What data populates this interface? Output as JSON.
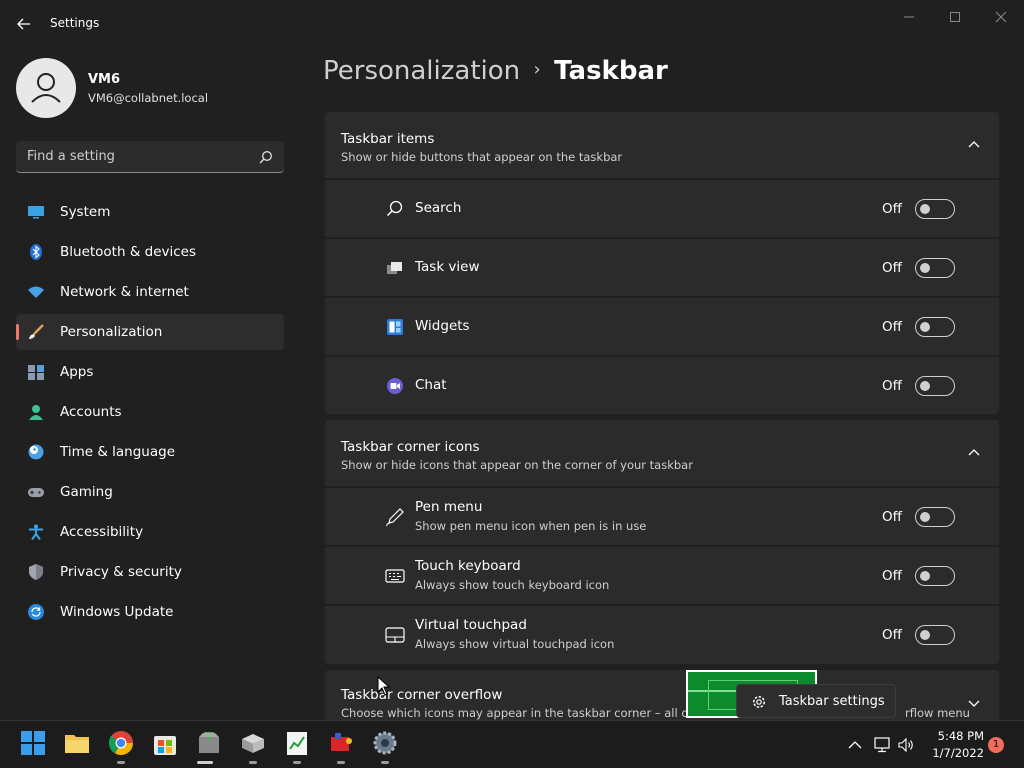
{
  "window": {
    "title": "Settings",
    "back_icon": "arrow-left-icon",
    "controls": [
      "minimize-icon",
      "restore-icon",
      "close-icon"
    ]
  },
  "profile": {
    "name": "VM6",
    "email": "VM6@collabnet.local"
  },
  "search": {
    "placeholder": "Find a setting",
    "value": ""
  },
  "nav": {
    "items": [
      {
        "label": "System",
        "icon": "monitor-icon",
        "active": false
      },
      {
        "label": "Bluetooth & devices",
        "icon": "bluetooth-icon",
        "active": false
      },
      {
        "label": "Network & internet",
        "icon": "wifi-icon",
        "active": false
      },
      {
        "label": "Personalization",
        "icon": "brush-icon",
        "active": true
      },
      {
        "label": "Apps",
        "icon": "apps-icon",
        "active": false
      },
      {
        "label": "Accounts",
        "icon": "person-icon",
        "active": false
      },
      {
        "label": "Time & language",
        "icon": "clock-globe-icon",
        "active": false
      },
      {
        "label": "Gaming",
        "icon": "gamepad-icon",
        "active": false
      },
      {
        "label": "Accessibility",
        "icon": "accessibility-icon",
        "active": false
      },
      {
        "label": "Privacy & security",
        "icon": "shield-icon",
        "active": false
      },
      {
        "label": "Windows Update",
        "icon": "update-icon",
        "active": false
      }
    ]
  },
  "breadcrumb": {
    "parent": "Personalization",
    "separator": "›",
    "current": "Taskbar"
  },
  "sections": {
    "taskbar_items": {
      "title": "Taskbar items",
      "subtitle": "Show or hide buttons that appear on the taskbar",
      "expanded": true,
      "rows": [
        {
          "title": "Search",
          "icon": "search-icon",
          "state": "Off"
        },
        {
          "title": "Task view",
          "icon": "task-view-icon",
          "state": "Off"
        },
        {
          "title": "Widgets",
          "icon": "widgets-icon",
          "state": "Off"
        },
        {
          "title": "Chat",
          "icon": "chat-icon",
          "state": "Off"
        }
      ]
    },
    "corner_icons": {
      "title": "Taskbar corner icons",
      "subtitle": "Show or hide icons that appear on the corner of your taskbar",
      "expanded": true,
      "rows": [
        {
          "title": "Pen menu",
          "subtitle": "Show pen menu icon when pen is in use",
          "icon": "pen-icon",
          "state": "Off"
        },
        {
          "title": "Touch keyboard",
          "subtitle": "Always show touch keyboard icon",
          "icon": "keyboard-icon",
          "state": "Off"
        },
        {
          "title": "Virtual touchpad",
          "subtitle": "Always show virtual touchpad icon",
          "icon": "touchpad-icon",
          "state": "Off"
        }
      ]
    },
    "corner_overflow": {
      "title": "Taskbar corner overflow",
      "subtitle": "Choose which icons may appear in the taskbar corner – all other",
      "subtitle_tail": "rflow menu",
      "expanded": false
    }
  },
  "tooltip": {
    "label": "Taskbar settings",
    "icon": "gear-icon"
  },
  "taskbar": {
    "apps": [
      "start-icon",
      "file-explorer-icon",
      "chrome-icon",
      "store-icon",
      "install-app-icon",
      "server-app-icon",
      "chart-app-icon",
      "media-app-icon",
      "settings-icon"
    ],
    "tray": [
      "chevron-up-icon",
      "network-icon",
      "volume-icon"
    ],
    "time": "5:48 PM",
    "date": "1/7/2022",
    "notification_count": "1"
  },
  "colors": {
    "background": "#202020",
    "card": "#2b2b2b",
    "accent": "#f0786a",
    "taskbar": "#1c1c1c"
  }
}
